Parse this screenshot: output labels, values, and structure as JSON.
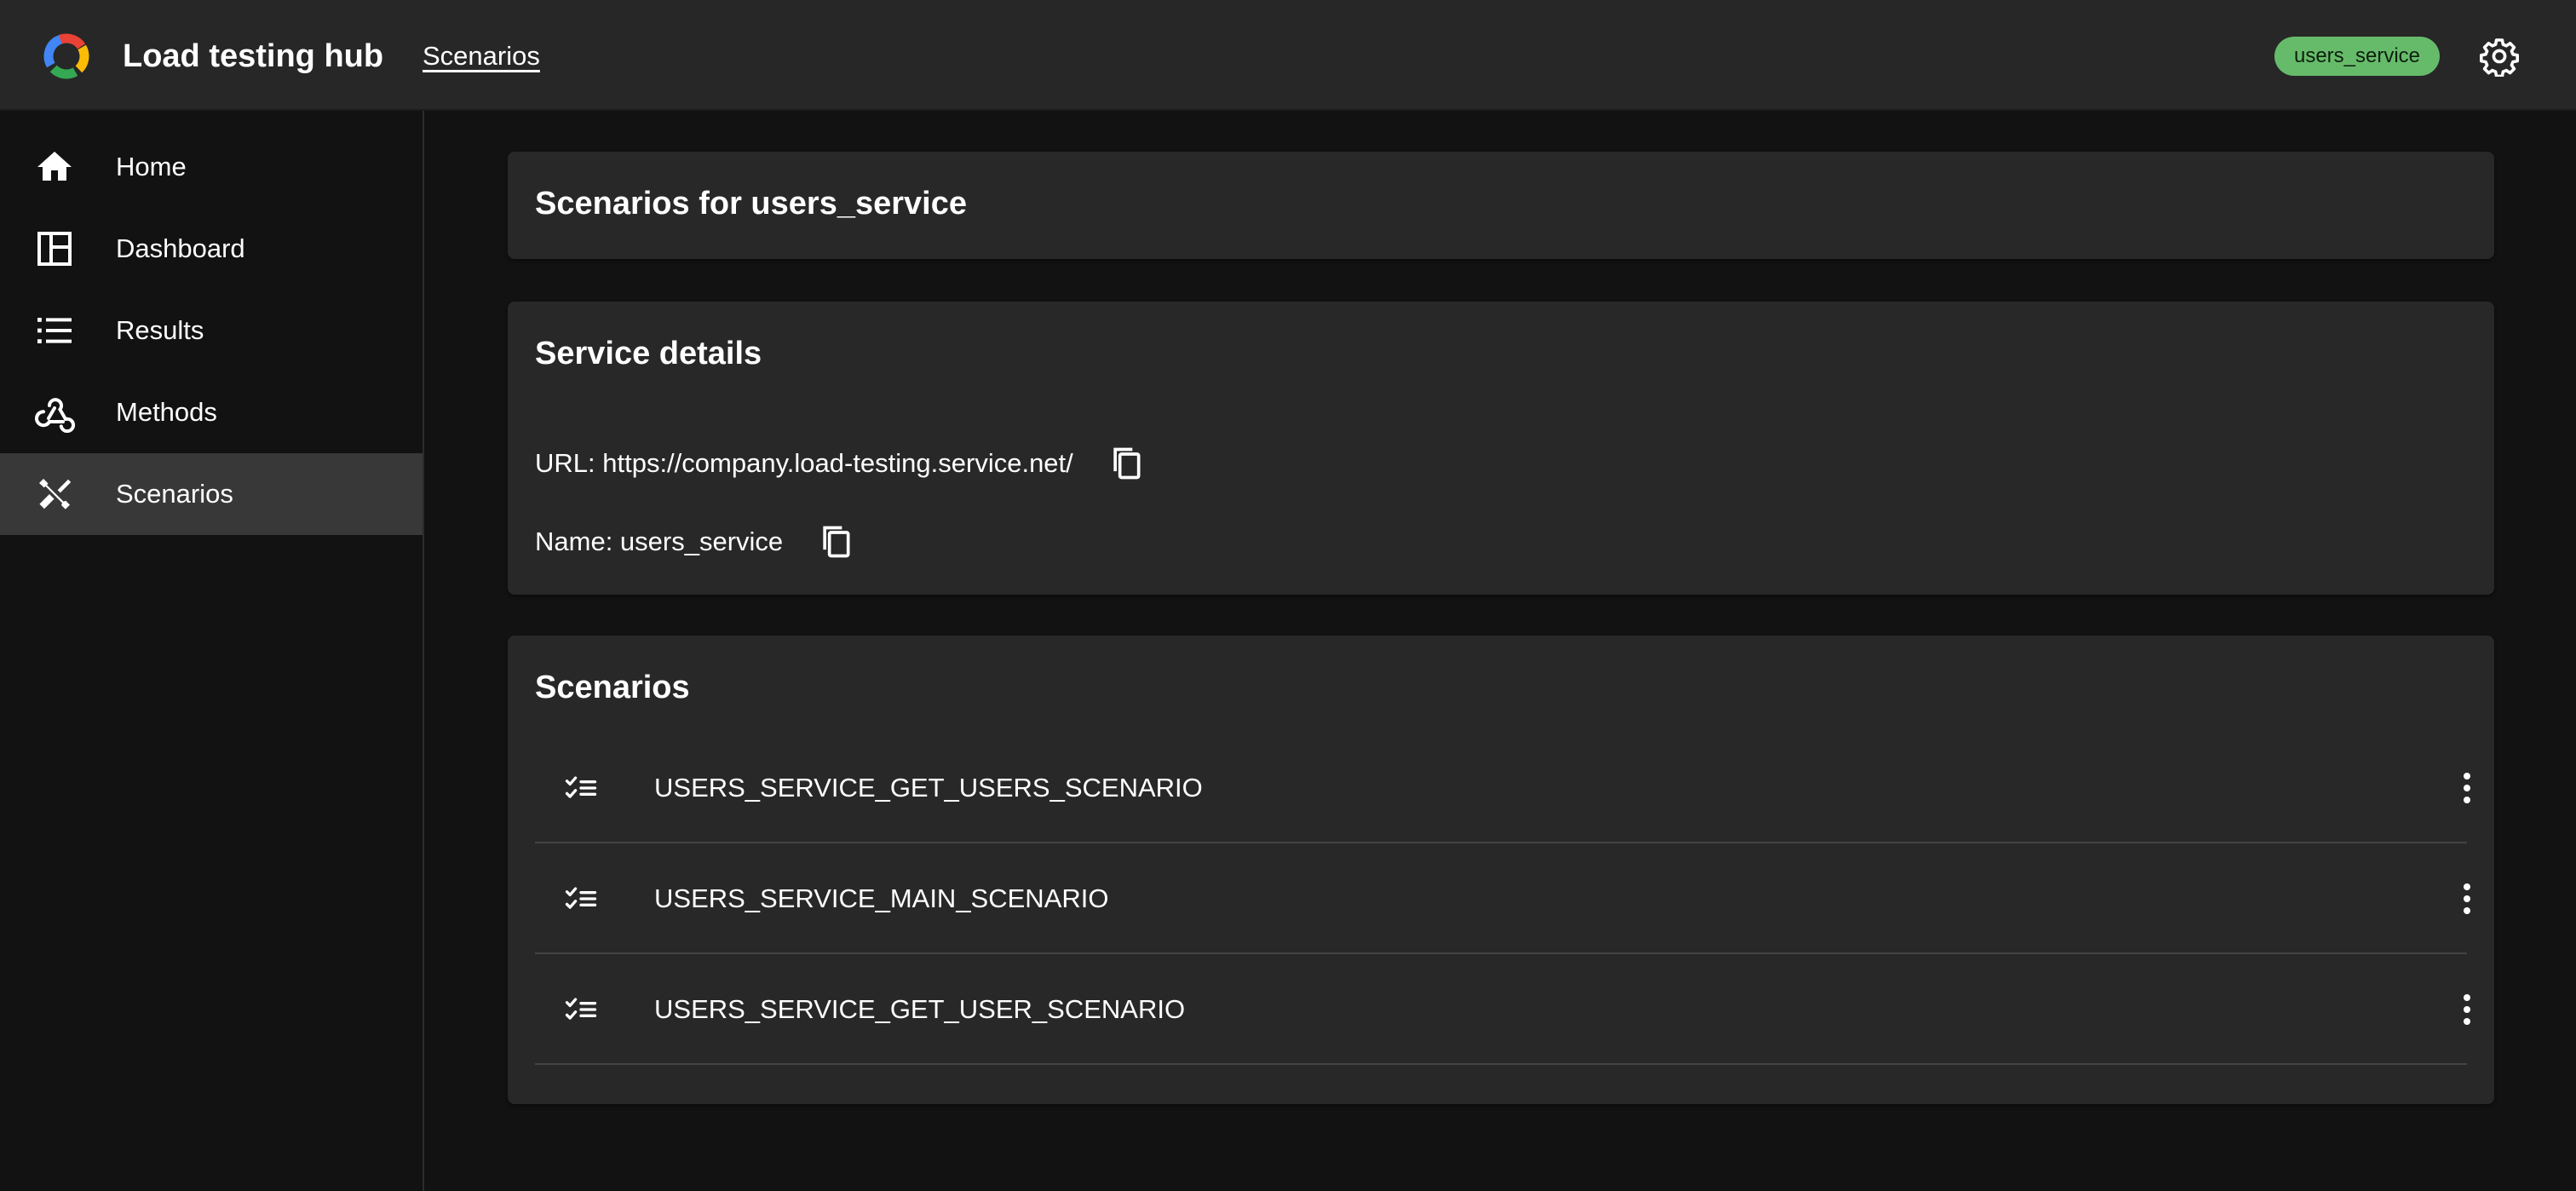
{
  "header": {
    "title": "Load testing hub",
    "breadcrumb": "Scenarios",
    "service_badge": "users_service",
    "logo_icon": "gauge-logo-icon",
    "settings_icon": "gear-icon"
  },
  "sidebar": {
    "items": [
      {
        "label": "Home",
        "icon": "home-icon",
        "active": false
      },
      {
        "label": "Dashboard",
        "icon": "dashboard-icon",
        "active": false
      },
      {
        "label": "Results",
        "icon": "list-icon",
        "active": false
      },
      {
        "label": "Methods",
        "icon": "webhook-icon",
        "active": false
      },
      {
        "label": "Scenarios",
        "icon": "tools-icon",
        "active": true
      }
    ]
  },
  "main": {
    "page_title": "Scenarios for users_service",
    "service_details": {
      "title": "Service details",
      "url_text": "URL: https://company.load-testing.service.net/",
      "name_text": "Name: users_service"
    },
    "scenarios": {
      "title": "Scenarios",
      "items": [
        {
          "name": "USERS_SERVICE_GET_USERS_SCENARIO"
        },
        {
          "name": "USERS_SERVICE_MAIN_SCENARIO"
        },
        {
          "name": "USERS_SERVICE_GET_USER_SCENARIO"
        }
      ]
    }
  },
  "colors": {
    "appbar": "#272727",
    "background": "#121212",
    "card": "#282828",
    "badge": "#66bb6a",
    "active_nav": "#383838"
  }
}
